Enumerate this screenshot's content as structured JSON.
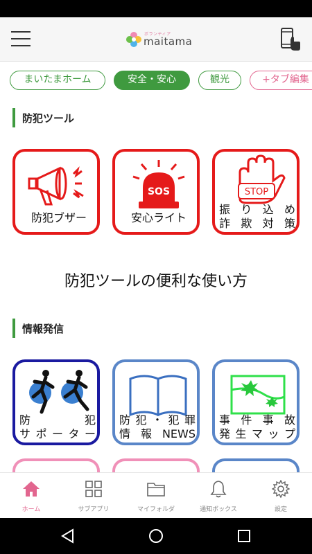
{
  "app": {
    "logo_small": "ボランティア",
    "logo_text": "maitama"
  },
  "tabs": [
    {
      "label": "まいたまホーム",
      "active": false
    },
    {
      "label": "安全・安心",
      "active": true
    },
    {
      "label": "観光",
      "active": false
    },
    {
      "label": "+タブ編集",
      "active": false
    }
  ],
  "sections": {
    "crime_tools": "防犯ツール",
    "info": "情報発信"
  },
  "tools": [
    {
      "label": "防犯ブザー",
      "icon": "megaphone-icon"
    },
    {
      "label": "安心ライト",
      "icon": "sos-light-icon",
      "badge": "SOS"
    },
    {
      "label_line1": "振り込め",
      "label_line2": "詐欺対策",
      "icon": "stop-hand-icon",
      "badge": "STOP"
    }
  ],
  "howto": "防犯ツールの便利な使い方",
  "info_tiles": [
    {
      "label_line1": "防　犯",
      "label_line2": "サポーター",
      "icon": "runners-icon"
    },
    {
      "label_line1": "防犯・犯罪",
      "label_line2": "情報NEWS",
      "icon": "book-icon"
    },
    {
      "label_line1": "事件事故",
      "label_line2": "発生マップ",
      "icon": "incident-map-icon"
    }
  ],
  "bottom_nav": [
    {
      "label": "ホーム",
      "icon": "home-icon",
      "active": true
    },
    {
      "label": "サブアプリ",
      "icon": "grid-icon",
      "active": false
    },
    {
      "label": "マイフォルダ",
      "icon": "folder-icon",
      "active": false
    },
    {
      "label": "通知ボックス",
      "icon": "bell-icon",
      "active": false
    },
    {
      "label": "設定",
      "icon": "gear-icon",
      "active": false
    }
  ],
  "colors": {
    "accent_green": "#3f9a3f",
    "accent_pink": "#e2668f",
    "tile_red": "#e51a1a",
    "tile_navy": "#1a1aa0",
    "tile_blue": "#5a86c8"
  }
}
